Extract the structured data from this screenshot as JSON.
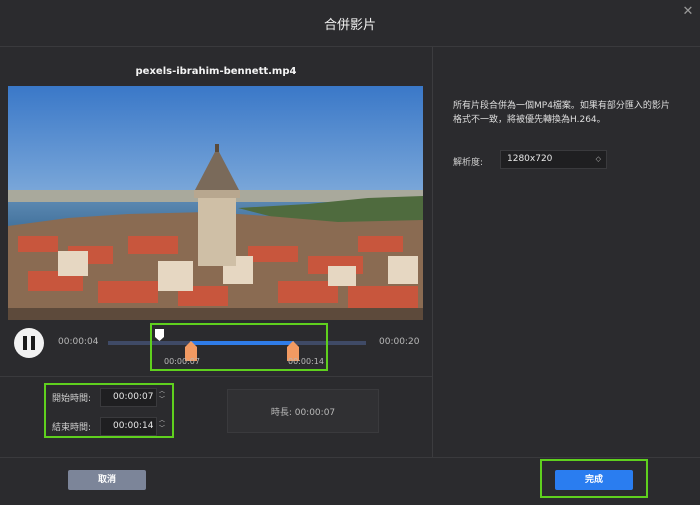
{
  "window": {
    "title": "合併影片",
    "close_icon": "close-icon"
  },
  "preview": {
    "filename": "pexels-ibrahim-bennett.mp4"
  },
  "timeline": {
    "current_time": "00:00:04",
    "total_time": "00:00:20",
    "selection_start_label": "00:00:07",
    "selection_end_label": "00:00:14",
    "playhead_fraction": 0.2,
    "selection_start_fraction": 0.35,
    "selection_end_fraction": 0.7
  },
  "trim": {
    "start_label": "開始時間:",
    "start_value": "00:00:07",
    "end_label": "結束時間:",
    "end_value": "00:00:14",
    "duration_text": "時長: 00:00:07"
  },
  "settings": {
    "info": "所有片段合併為一個MP4檔案。如果有部分匯入的影片格式不一致，將被優先轉換為H.264。",
    "resolution_label": "解析度:",
    "resolution_value": "1280x720"
  },
  "footer": {
    "cancel_label": "取消",
    "done_label": "完成"
  },
  "colors": {
    "accent": "#2a7df0",
    "highlight": "#5fd01e",
    "handle": "#f29a62",
    "cancel": "#7c8599"
  }
}
